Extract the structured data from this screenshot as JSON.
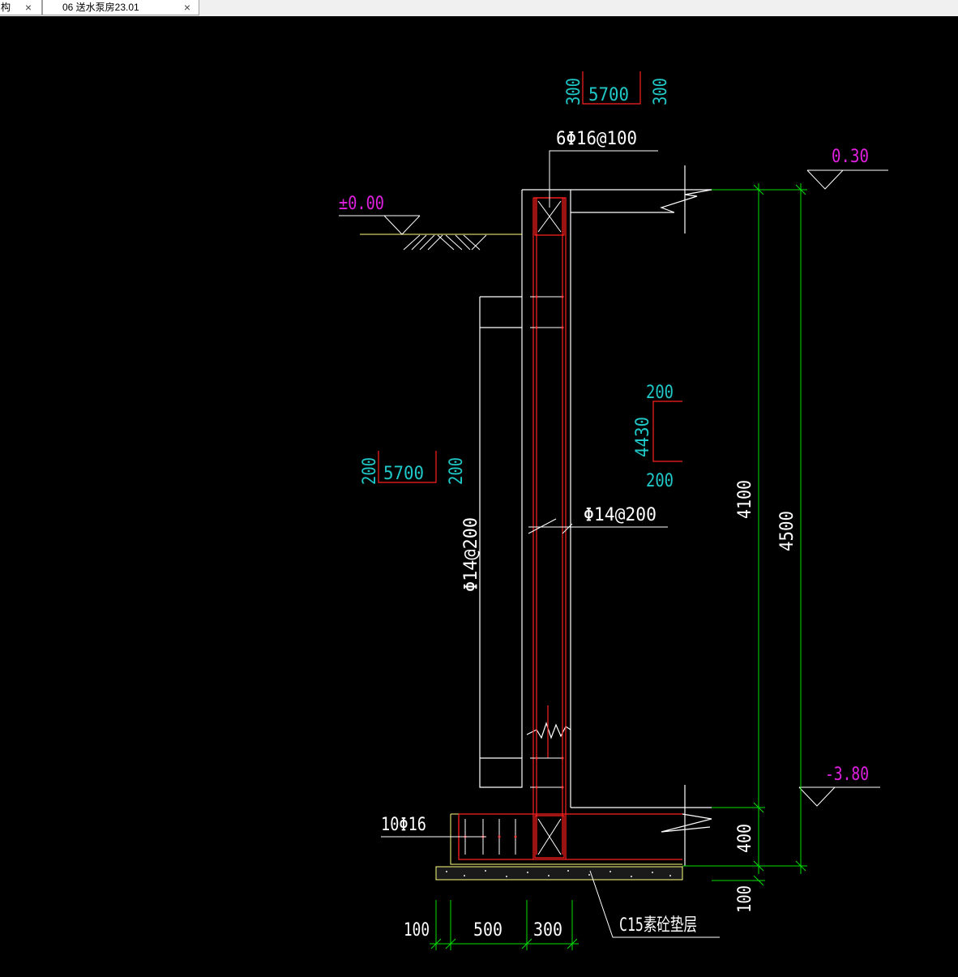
{
  "tabs": [
    {
      "label": "构",
      "close": "×"
    },
    {
      "label": "06 送水泵房23.01",
      "close": "×"
    }
  ],
  "colors": {
    "background": "#000000",
    "wall": "#ffffff",
    "rebar": "#ff2020",
    "dimension": "#00e000",
    "elevation": "#e020e0",
    "bar_shape": "#20c8c8",
    "ground": "#ffff80"
  },
  "drawing": {
    "elevations": {
      "ground": "±0.00",
      "top": "0.30",
      "bottom": "-3.80"
    },
    "rebar_labels": {
      "top_bars": "6Φ16@100",
      "inner_wall": "Φ14@200",
      "outer_wall": "Φ14@200",
      "footing_bars": "10Φ16"
    },
    "bar_shapes": {
      "top": {
        "left": "300",
        "middle": "5700",
        "right": "300"
      },
      "mid": {
        "left": "200",
        "middle": "5700",
        "right": "200"
      },
      "stirrup": {
        "top": "200",
        "side": "4430",
        "bottom": "200"
      }
    },
    "dimensions": {
      "wall_height": "4100",
      "total_height": "4500",
      "footing_thickness": "400",
      "blinding_thickness": "100",
      "base_left": "100",
      "base_mid": "500",
      "base_right": "300"
    },
    "blinding_label": "C15素砼垫层"
  }
}
